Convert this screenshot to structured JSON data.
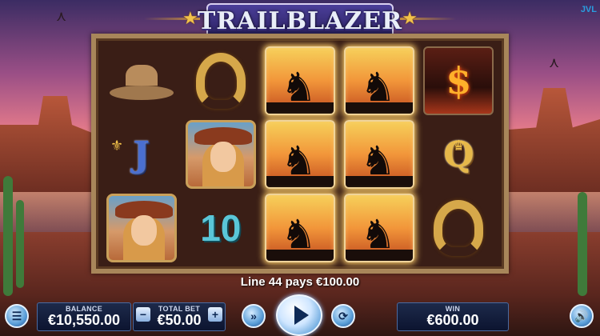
{
  "game": {
    "title": "TRAILBLAZER",
    "vendor": "JVL"
  },
  "reels": [
    [
      "cowboy-hat",
      "letter-j",
      "cowgirl"
    ],
    [
      "horseshoe",
      "cowgirl",
      "ten"
    ],
    [
      "horse-rider",
      "horse-rider",
      "horse-rider"
    ],
    [
      "horse-rider",
      "horse-rider",
      "horse-rider"
    ],
    [
      "dollar",
      "letter-q",
      "horseshoe"
    ]
  ],
  "symbols": {
    "letter_j": "J",
    "letter_q": "Q",
    "ten": "10",
    "dollar": "$"
  },
  "win_message": "Line 44 pays €100.00",
  "controls": {
    "balance_label": "BALANCE",
    "balance_value": "€10,550.00",
    "total_bet_label": "TOTAL BET",
    "total_bet_value": "€50.00",
    "minus": "−",
    "plus": "+",
    "win_label": "WIN",
    "win_value": "€600.00"
  }
}
